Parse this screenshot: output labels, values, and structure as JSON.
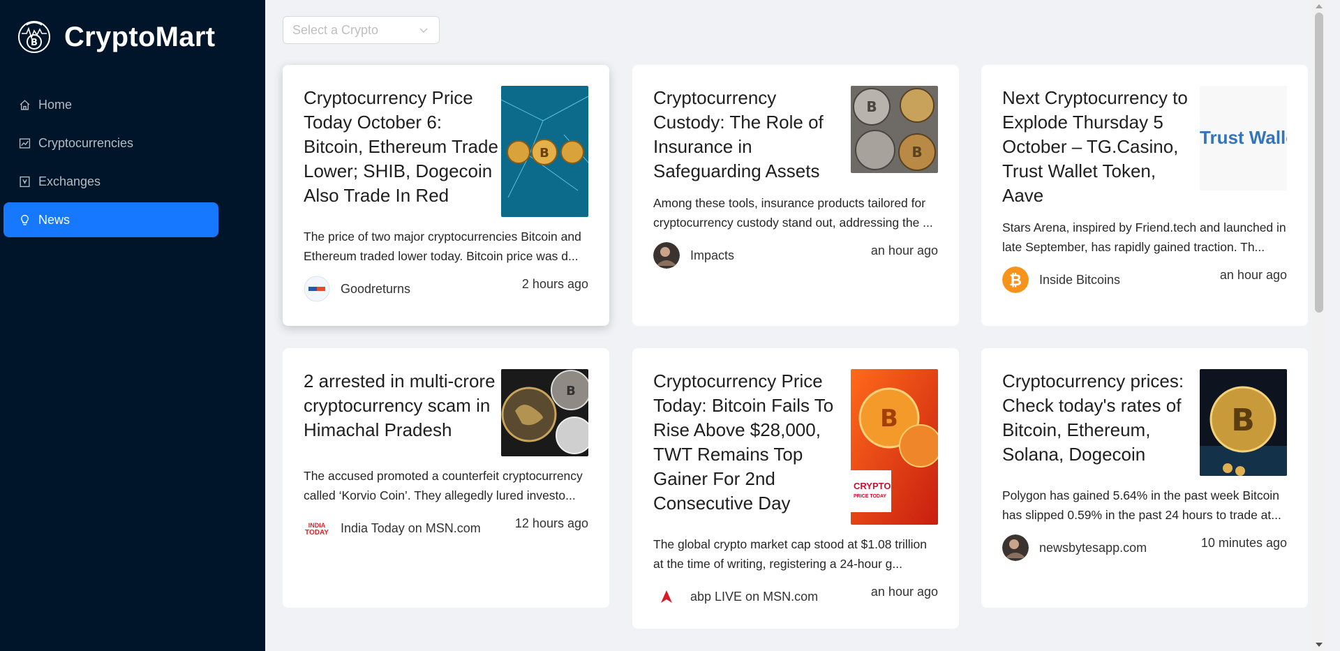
{
  "app": {
    "name": "CryptoMart",
    "logo_icon": "crypto-coin-logo-icon",
    "colors": {
      "sidebar": "#001529",
      "accent": "#1677ff",
      "background": "#f0f2f5"
    }
  },
  "menu": [
    {
      "label": "Home",
      "icon": "home-icon",
      "active": false
    },
    {
      "label": "Cryptocurrencies",
      "icon": "chart-icon",
      "active": false
    },
    {
      "label": "Exchanges",
      "icon": "exchange-icon",
      "active": false
    },
    {
      "label": "News",
      "icon": "bulb-icon",
      "active": true
    }
  ],
  "select": {
    "placeholder": "Select a Crypto"
  },
  "news": [
    {
      "title": "Cryptocurrency Price Today October 6: Bitcoin, Ethereum Trade Lower; SHIB, Dogecoin Also Trade In Red",
      "description": "The price of two major cryptocurrencies Bitcoin and Ethereum traded lower today. Bitcoin price was d...",
      "provider": "Goodreturns",
      "time": "2 hours ago"
    },
    {
      "title": "Cryptocurrency Custody: The Role of Insurance in Safeguarding Assets",
      "description": "Among these tools, insurance products tailored for cryptocurrency custody stand out, addressing the ...",
      "provider": "Impacts",
      "time": "an hour ago"
    },
    {
      "title": "Next Cryptocurrency to Explode Thursday 5 October – TG.Casino, Trust Wallet Token, Aave",
      "description": "Stars Arena, inspired by Friend.tech and launched in late September, has rapidly gained traction. Th...",
      "provider": "Inside Bitcoins",
      "time": "an hour ago",
      "thumb_text": "Trust Wallet"
    },
    {
      "title": "2 arrested in multi-crore cryptocurrency scam in Himachal Pradesh",
      "description": "The accused promoted a counterfeit cryptocurrency called ‘Korvio Coin’. They allegedly lured investo...",
      "provider": "India Today on MSN.com",
      "time": "12 hours ago",
      "provider_logo_text": [
        "INDIA",
        "TODAY"
      ]
    },
    {
      "title": "Cryptocurrency Price Today: Bitcoin Fails To Rise Above $28,000, TWT Remains Top Gainer For 2nd Consecutive Day",
      "description": "The global crypto market cap stood at $1.08 trillion at the time of writing, registering a 24-hour g...",
      "provider": "abp LIVE on MSN.com",
      "time": "an hour ago",
      "thumb_text": [
        "CRYPTO",
        "PRICE TODAY"
      ]
    },
    {
      "title": "Cryptocurrency prices: Check today's rates of Bitcoin, Ethereum, Solana, Dogecoin",
      "description": "Polygon has gained 5.64% in the past week Bitcoin has slipped 0.59% in the past 24 hours to trade at...",
      "provider": "newsbytesapp.com",
      "time": "10 minutes ago"
    }
  ]
}
